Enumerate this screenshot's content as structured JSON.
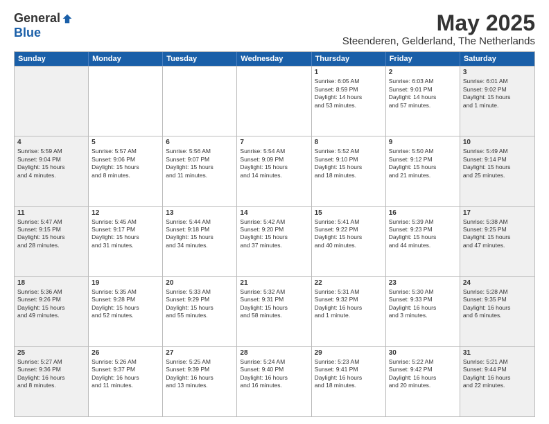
{
  "logo": {
    "general": "General",
    "blue": "Blue"
  },
  "title": "May 2025",
  "subtitle": "Steenderen, Gelderland, The Netherlands",
  "headers": [
    "Sunday",
    "Monday",
    "Tuesday",
    "Wednesday",
    "Thursday",
    "Friday",
    "Saturday"
  ],
  "rows": [
    [
      {
        "day": "",
        "info": ""
      },
      {
        "day": "",
        "info": ""
      },
      {
        "day": "",
        "info": ""
      },
      {
        "day": "",
        "info": ""
      },
      {
        "day": "1",
        "info": "Sunrise: 6:05 AM\nSunset: 8:59 PM\nDaylight: 14 hours\nand 53 minutes."
      },
      {
        "day": "2",
        "info": "Sunrise: 6:03 AM\nSunset: 9:01 PM\nDaylight: 14 hours\nand 57 minutes."
      },
      {
        "day": "3",
        "info": "Sunrise: 6:01 AM\nSunset: 9:02 PM\nDaylight: 15 hours\nand 1 minute."
      }
    ],
    [
      {
        "day": "4",
        "info": "Sunrise: 5:59 AM\nSunset: 9:04 PM\nDaylight: 15 hours\nand 4 minutes."
      },
      {
        "day": "5",
        "info": "Sunrise: 5:57 AM\nSunset: 9:06 PM\nDaylight: 15 hours\nand 8 minutes."
      },
      {
        "day": "6",
        "info": "Sunrise: 5:56 AM\nSunset: 9:07 PM\nDaylight: 15 hours\nand 11 minutes."
      },
      {
        "day": "7",
        "info": "Sunrise: 5:54 AM\nSunset: 9:09 PM\nDaylight: 15 hours\nand 14 minutes."
      },
      {
        "day": "8",
        "info": "Sunrise: 5:52 AM\nSunset: 9:10 PM\nDaylight: 15 hours\nand 18 minutes."
      },
      {
        "day": "9",
        "info": "Sunrise: 5:50 AM\nSunset: 9:12 PM\nDaylight: 15 hours\nand 21 minutes."
      },
      {
        "day": "10",
        "info": "Sunrise: 5:49 AM\nSunset: 9:14 PM\nDaylight: 15 hours\nand 25 minutes."
      }
    ],
    [
      {
        "day": "11",
        "info": "Sunrise: 5:47 AM\nSunset: 9:15 PM\nDaylight: 15 hours\nand 28 minutes."
      },
      {
        "day": "12",
        "info": "Sunrise: 5:45 AM\nSunset: 9:17 PM\nDaylight: 15 hours\nand 31 minutes."
      },
      {
        "day": "13",
        "info": "Sunrise: 5:44 AM\nSunset: 9:18 PM\nDaylight: 15 hours\nand 34 minutes."
      },
      {
        "day": "14",
        "info": "Sunrise: 5:42 AM\nSunset: 9:20 PM\nDaylight: 15 hours\nand 37 minutes."
      },
      {
        "day": "15",
        "info": "Sunrise: 5:41 AM\nSunset: 9:22 PM\nDaylight: 15 hours\nand 40 minutes."
      },
      {
        "day": "16",
        "info": "Sunrise: 5:39 AM\nSunset: 9:23 PM\nDaylight: 15 hours\nand 44 minutes."
      },
      {
        "day": "17",
        "info": "Sunrise: 5:38 AM\nSunset: 9:25 PM\nDaylight: 15 hours\nand 47 minutes."
      }
    ],
    [
      {
        "day": "18",
        "info": "Sunrise: 5:36 AM\nSunset: 9:26 PM\nDaylight: 15 hours\nand 49 minutes."
      },
      {
        "day": "19",
        "info": "Sunrise: 5:35 AM\nSunset: 9:28 PM\nDaylight: 15 hours\nand 52 minutes."
      },
      {
        "day": "20",
        "info": "Sunrise: 5:33 AM\nSunset: 9:29 PM\nDaylight: 15 hours\nand 55 minutes."
      },
      {
        "day": "21",
        "info": "Sunrise: 5:32 AM\nSunset: 9:31 PM\nDaylight: 15 hours\nand 58 minutes."
      },
      {
        "day": "22",
        "info": "Sunrise: 5:31 AM\nSunset: 9:32 PM\nDaylight: 16 hours\nand 1 minute."
      },
      {
        "day": "23",
        "info": "Sunrise: 5:30 AM\nSunset: 9:33 PM\nDaylight: 16 hours\nand 3 minutes."
      },
      {
        "day": "24",
        "info": "Sunrise: 5:28 AM\nSunset: 9:35 PM\nDaylight: 16 hours\nand 6 minutes."
      }
    ],
    [
      {
        "day": "25",
        "info": "Sunrise: 5:27 AM\nSunset: 9:36 PM\nDaylight: 16 hours\nand 8 minutes."
      },
      {
        "day": "26",
        "info": "Sunrise: 5:26 AM\nSunset: 9:37 PM\nDaylight: 16 hours\nand 11 minutes."
      },
      {
        "day": "27",
        "info": "Sunrise: 5:25 AM\nSunset: 9:39 PM\nDaylight: 16 hours\nand 13 minutes."
      },
      {
        "day": "28",
        "info": "Sunrise: 5:24 AM\nSunset: 9:40 PM\nDaylight: 16 hours\nand 16 minutes."
      },
      {
        "day": "29",
        "info": "Sunrise: 5:23 AM\nSunset: 9:41 PM\nDaylight: 16 hours\nand 18 minutes."
      },
      {
        "day": "30",
        "info": "Sunrise: 5:22 AM\nSunset: 9:42 PM\nDaylight: 16 hours\nand 20 minutes."
      },
      {
        "day": "31",
        "info": "Sunrise: 5:21 AM\nSunset: 9:44 PM\nDaylight: 16 hours\nand 22 minutes."
      }
    ]
  ]
}
